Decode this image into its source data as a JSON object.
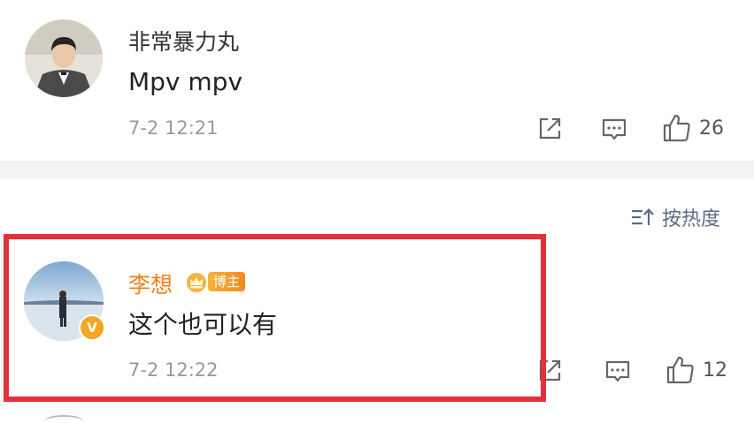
{
  "comments": [
    {
      "username": "非常暴力丸",
      "text": "Mpv mpv",
      "timestamp": "7-2 12:21",
      "likes": "26",
      "verified": false
    },
    {
      "username": "李想",
      "badge": "博主",
      "text": "这个也可以有",
      "timestamp": "7-2 12:22",
      "likes": "12",
      "verified": true,
      "verified_mark": "V",
      "highlighted": true
    }
  ],
  "sort": {
    "label": "按热度",
    "icon": "sort-icon"
  },
  "icons": {
    "share": "share-icon",
    "reply": "comment-icon",
    "like": "thumbs-up-icon"
  },
  "colors": {
    "highlight": "#e0313a",
    "vip_name": "#f07f1a",
    "badge": "#f5a623",
    "sort_text": "#5a6b85"
  }
}
